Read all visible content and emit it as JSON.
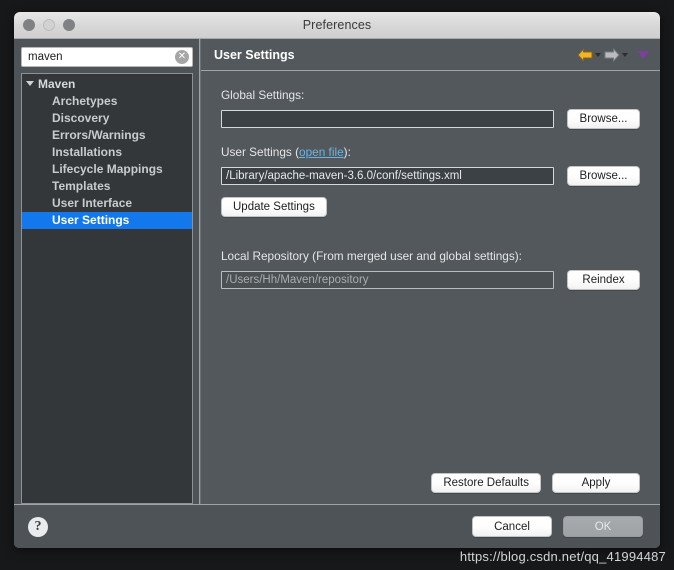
{
  "window": {
    "title": "Preferences",
    "traffic_lights": [
      "close",
      "minimize",
      "zoom"
    ]
  },
  "sidebar": {
    "search": {
      "value": "maven",
      "placeholder": "",
      "clear_icon": "clear-circle-icon"
    },
    "tree": [
      {
        "label": "Maven",
        "level": 0,
        "expanded": true,
        "selected": false
      },
      {
        "label": "Archetypes",
        "level": 1,
        "selected": false
      },
      {
        "label": "Discovery",
        "level": 1,
        "selected": false
      },
      {
        "label": "Errors/Warnings",
        "level": 1,
        "selected": false
      },
      {
        "label": "Installations",
        "level": 1,
        "selected": false
      },
      {
        "label": "Lifecycle Mappings",
        "level": 1,
        "selected": false
      },
      {
        "label": "Templates",
        "level": 1,
        "selected": false
      },
      {
        "label": "User Interface",
        "level": 1,
        "selected": false
      },
      {
        "label": "User Settings",
        "level": 1,
        "selected": true
      }
    ]
  },
  "content": {
    "title": "User Settings",
    "nav": {
      "back_icon": "back-arrow-icon",
      "back_caret_icon": "chevron-down-icon",
      "forward_icon": "forward-arrow-icon",
      "forward_caret_icon": "chevron-down-icon",
      "menu_caret_icon": "chevron-down-icon"
    },
    "fields": {
      "global_settings": {
        "label": "Global Settings:",
        "value": "",
        "button": "Browse..."
      },
      "user_settings": {
        "label_prefix": "User Settings (",
        "link": "open file",
        "label_suffix": "):",
        "value": "/Library/apache-maven-3.6.0/conf/settings.xml",
        "button": "Browse..."
      },
      "update_settings_button": "Update Settings",
      "local_repository": {
        "label": "Local Repository (From merged user and global settings):",
        "value": "/Users/Hh/Maven/repository",
        "button": "Reindex",
        "disabled": true
      }
    },
    "panel_actions": {
      "restore_defaults": "Restore Defaults",
      "apply": "Apply"
    }
  },
  "footer": {
    "help_icon": "help-question-icon",
    "cancel": "Cancel",
    "ok": "OK",
    "ok_disabled": true
  },
  "watermark": "https://blog.csdn.net/qq_41994487",
  "colors": {
    "window_bg": "#4e5357",
    "content_bg": "#53585c",
    "tree_bg": "#333739",
    "selection_blue": "#1378ec",
    "link_blue": "#69b4e4",
    "back_arrow_gold": "#f0b429",
    "forward_arrow_gray": "#b9bcbe",
    "menu_caret_purple": "#7b3f9d",
    "field_bg": "#3c4145"
  }
}
